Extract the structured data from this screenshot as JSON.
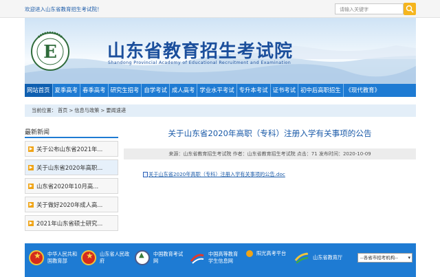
{
  "topbar": {
    "welcome": "欢迎进入山东省教育招生考试院！",
    "search_placeholder": "请输入关键字"
  },
  "banner": {
    "title": "山东省教育招生考试院",
    "subtitle": "Shandong Provincial Academy of Educational Recruitment and Examination",
    "logo_text": "山东省教育招生考试院"
  },
  "nav": {
    "items": [
      {
        "label": "网站首页"
      },
      {
        "label": "夏季高考"
      },
      {
        "label": "春季高考"
      },
      {
        "label": "研究生招考"
      },
      {
        "label": "自学考试"
      },
      {
        "label": "成人高考"
      },
      {
        "label": "学业水平考试"
      },
      {
        "label": "专升本考试"
      },
      {
        "label": "证书考试"
      },
      {
        "label": "初中后高职招生"
      },
      {
        "label": "《现代教育》"
      }
    ]
  },
  "breadcrumb": {
    "prefix": "当前位置：",
    "items": [
      "首页",
      "信息与政策",
      "要闻速递"
    ],
    "separator": ">"
  },
  "sidebar": {
    "title": "最新新闻",
    "items": [
      {
        "label": "关于公布山东省2021年..."
      },
      {
        "label": "关于山东省2020年高职..."
      },
      {
        "label": "山东省2020年10月高..."
      },
      {
        "label": "关于做好2020年成人高..."
      },
      {
        "label": "2021年山东省硕士研究..."
      }
    ]
  },
  "article": {
    "title": "关于山东省2020年高职（专科）注册入学有关事项的公告",
    "meta": "来源：山东省教育招生考试院 作者：山东省教育招生考试院 点击：71 发布时间：2020-10-09",
    "attachment": "关于山东省2020年高职（专科）注册入学有关事项的公告.doc"
  },
  "footer": {
    "links": [
      {
        "label_line1": "中华人民共和",
        "label_line2": "国教育部"
      },
      {
        "label_line1": "山东省人民政",
        "label_line2": "府"
      },
      {
        "label_line1": "中国教育考试",
        "label_line2": "网"
      },
      {
        "label_line1": "中国高等教育",
        "label_line2": "学生信息网"
      },
      {
        "label_line1": "阳光高考平台",
        "label_line2": ""
      },
      {
        "label_line1": "山东省教育厅",
        "label_line2": ""
      }
    ],
    "select_value": "--各省市招考机构--"
  },
  "colors": {
    "primary": "#1e7bd3",
    "title_blue": "#1b4f9c",
    "accent": "#f0a416"
  }
}
